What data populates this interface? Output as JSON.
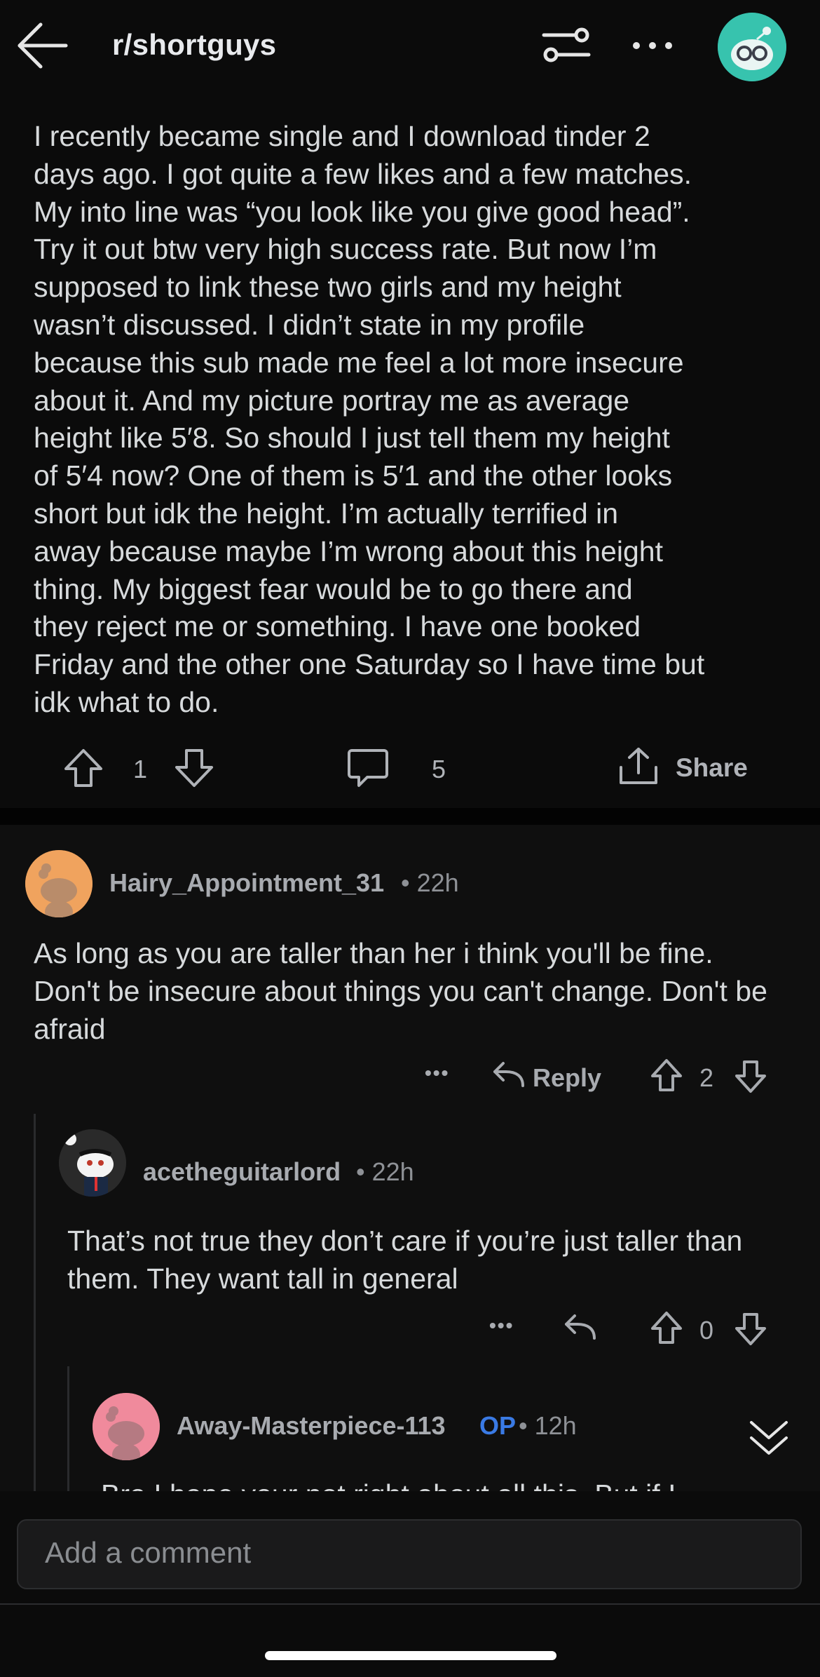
{
  "header": {
    "subreddit": "r/shortguys",
    "icons": [
      "back-arrow-icon",
      "filter-icon",
      "more-icon",
      "avatar"
    ]
  },
  "post": {
    "body": "I recently became single and I download tinder 2\ndays ago. I got quite a few likes and a few matches.\nMy into line was “you look like you give good head”.\nTry it out btw very high success rate. But now I’m\nsupposed to link these two girls and my height\nwasn’t discussed. I didn’t state in my profile\nbecause this sub made me feel a lot more insecure\nabout it. And my picture portray me as average\nheight like 5′8. So should I just tell them my height\nof 5′4 now? One of them is 5′1 and the other looks\nshort but idk the height. I’m actually terrified in\naway because maybe I’m wrong about this height\nthing. My biggest fear would be to go there and\nthey reject me or something. I have one booked\nFriday and the other one Saturday so I have time but\nidk what to do.",
    "votes": "1",
    "comments": "5",
    "share_label": "Share"
  },
  "comments": [
    {
      "username": "Hairy_Appointment_31",
      "meta": " • 22h",
      "text": "As long as you are taller than her i think you'll be fine. Don't be insecure about things you can't change. Don't be afraid",
      "reply_label": "Reply",
      "more": "•••",
      "votes": "2"
    },
    {
      "username": "acetheguitarlord",
      "meta": " • 22h",
      "text": "That’s not true they don’t care if you’re just taller than them. They want tall in general",
      "more": "•••",
      "votes": "0"
    },
    {
      "username": "Away-Masterpiece-113",
      "op_badge": "OP",
      "meta": " • 12h",
      "text_partial": "Bro I hope your not right about all this. But if I"
    }
  ],
  "composer": {
    "placeholder": "Add a comment"
  },
  "colors": {
    "background": "#0b0b0b",
    "text": "#d7dadc",
    "muted": "#a8abb0",
    "op_blue": "#3a7ae4",
    "avatar_teal": "#37c3ae",
    "avatar_orange": "#f0a35e",
    "avatar_pink": "#f08a9c"
  }
}
